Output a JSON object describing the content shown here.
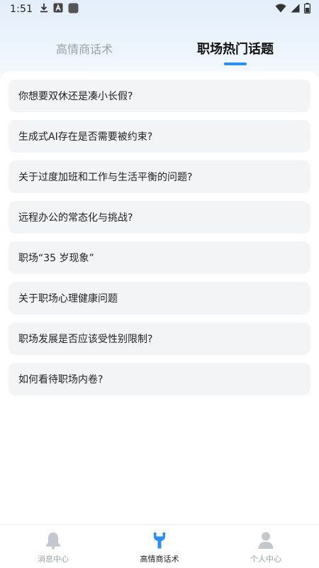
{
  "status_bar": {
    "time": "1:51",
    "icons": [
      "download-icon",
      "a-icon",
      "app-square-icon",
      "wifi-icon",
      "signal-icon",
      "battery-icon"
    ]
  },
  "tabs": [
    {
      "label": "高情商话术",
      "active": false
    },
    {
      "label": "职场热门话题",
      "active": true
    }
  ],
  "accent_color": "#2b8ff2",
  "questions": [
    "你想要双休还是凑小长假?",
    "生成式AI存在是否需要被约束?",
    "关于过度加班和工作与生活平衡的问题?",
    "远程办公的常态化与挑战?",
    "职场“35 岁现象”",
    "关于职场心理健康问题",
    "职场发展是否应该受性别限制?",
    "如何看待职场内卷?"
  ],
  "bottom_nav": [
    {
      "label": "消息中心",
      "icon": "bell-icon",
      "active": false
    },
    {
      "label": "高情商话术",
      "icon": "wrench-icon",
      "active": true
    },
    {
      "label": "个人中心",
      "icon": "person-icon",
      "active": false
    }
  ]
}
